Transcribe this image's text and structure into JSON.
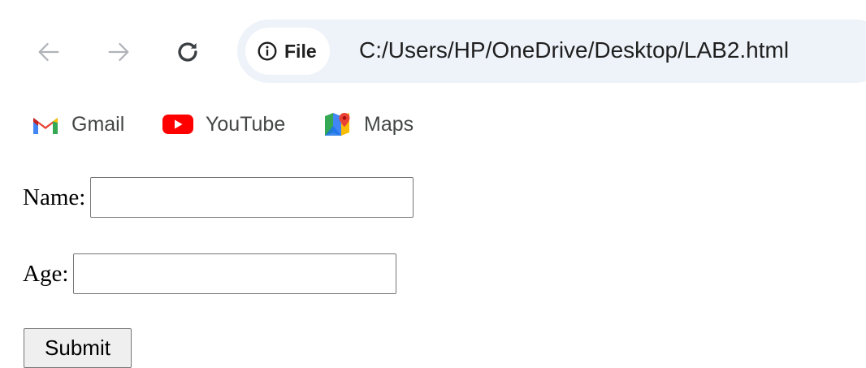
{
  "toolbar": {
    "back_icon": "arrow-left-icon",
    "forward_icon": "arrow-right-icon",
    "reload_icon": "reload-icon",
    "site_info_label": "File",
    "url": "C:/Users/HP/OneDrive/Desktop/LAB2.html"
  },
  "bookmarks": [
    {
      "label": "Gmail",
      "icon": "gmail-icon"
    },
    {
      "label": "YouTube",
      "icon": "youtube-icon"
    },
    {
      "label": "Maps",
      "icon": "maps-icon"
    }
  ],
  "form": {
    "name_label": "Name:",
    "name_value": "",
    "age_label": "Age:",
    "age_value": "",
    "submit_label": "Submit"
  },
  "colors": {
    "omnibox_bg": "#eef2f9",
    "icon_gray": "#5f6368",
    "youtube_red": "#ff0000",
    "button_bg": "#efefef"
  }
}
